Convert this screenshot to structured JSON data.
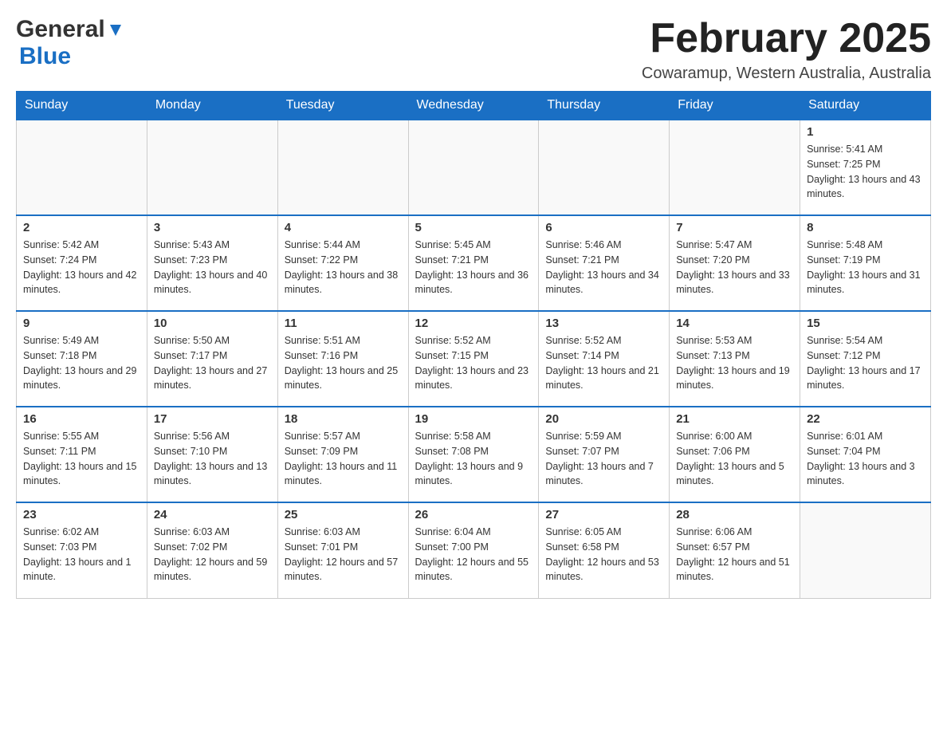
{
  "header": {
    "logo_general": "General",
    "logo_blue": "Blue",
    "month_title": "February 2025",
    "location": "Cowaramup, Western Australia, Australia"
  },
  "weekdays": [
    "Sunday",
    "Monday",
    "Tuesday",
    "Wednesday",
    "Thursday",
    "Friday",
    "Saturday"
  ],
  "weeks": [
    [
      {
        "day": "",
        "info": ""
      },
      {
        "day": "",
        "info": ""
      },
      {
        "day": "",
        "info": ""
      },
      {
        "day": "",
        "info": ""
      },
      {
        "day": "",
        "info": ""
      },
      {
        "day": "",
        "info": ""
      },
      {
        "day": "1",
        "info": "Sunrise: 5:41 AM\nSunset: 7:25 PM\nDaylight: 13 hours and 43 minutes."
      }
    ],
    [
      {
        "day": "2",
        "info": "Sunrise: 5:42 AM\nSunset: 7:24 PM\nDaylight: 13 hours and 42 minutes."
      },
      {
        "day": "3",
        "info": "Sunrise: 5:43 AM\nSunset: 7:23 PM\nDaylight: 13 hours and 40 minutes."
      },
      {
        "day": "4",
        "info": "Sunrise: 5:44 AM\nSunset: 7:22 PM\nDaylight: 13 hours and 38 minutes."
      },
      {
        "day": "5",
        "info": "Sunrise: 5:45 AM\nSunset: 7:21 PM\nDaylight: 13 hours and 36 minutes."
      },
      {
        "day": "6",
        "info": "Sunrise: 5:46 AM\nSunset: 7:21 PM\nDaylight: 13 hours and 34 minutes."
      },
      {
        "day": "7",
        "info": "Sunrise: 5:47 AM\nSunset: 7:20 PM\nDaylight: 13 hours and 33 minutes."
      },
      {
        "day": "8",
        "info": "Sunrise: 5:48 AM\nSunset: 7:19 PM\nDaylight: 13 hours and 31 minutes."
      }
    ],
    [
      {
        "day": "9",
        "info": "Sunrise: 5:49 AM\nSunset: 7:18 PM\nDaylight: 13 hours and 29 minutes."
      },
      {
        "day": "10",
        "info": "Sunrise: 5:50 AM\nSunset: 7:17 PM\nDaylight: 13 hours and 27 minutes."
      },
      {
        "day": "11",
        "info": "Sunrise: 5:51 AM\nSunset: 7:16 PM\nDaylight: 13 hours and 25 minutes."
      },
      {
        "day": "12",
        "info": "Sunrise: 5:52 AM\nSunset: 7:15 PM\nDaylight: 13 hours and 23 minutes."
      },
      {
        "day": "13",
        "info": "Sunrise: 5:52 AM\nSunset: 7:14 PM\nDaylight: 13 hours and 21 minutes."
      },
      {
        "day": "14",
        "info": "Sunrise: 5:53 AM\nSunset: 7:13 PM\nDaylight: 13 hours and 19 minutes."
      },
      {
        "day": "15",
        "info": "Sunrise: 5:54 AM\nSunset: 7:12 PM\nDaylight: 13 hours and 17 minutes."
      }
    ],
    [
      {
        "day": "16",
        "info": "Sunrise: 5:55 AM\nSunset: 7:11 PM\nDaylight: 13 hours and 15 minutes."
      },
      {
        "day": "17",
        "info": "Sunrise: 5:56 AM\nSunset: 7:10 PM\nDaylight: 13 hours and 13 minutes."
      },
      {
        "day": "18",
        "info": "Sunrise: 5:57 AM\nSunset: 7:09 PM\nDaylight: 13 hours and 11 minutes."
      },
      {
        "day": "19",
        "info": "Sunrise: 5:58 AM\nSunset: 7:08 PM\nDaylight: 13 hours and 9 minutes."
      },
      {
        "day": "20",
        "info": "Sunrise: 5:59 AM\nSunset: 7:07 PM\nDaylight: 13 hours and 7 minutes."
      },
      {
        "day": "21",
        "info": "Sunrise: 6:00 AM\nSunset: 7:06 PM\nDaylight: 13 hours and 5 minutes."
      },
      {
        "day": "22",
        "info": "Sunrise: 6:01 AM\nSunset: 7:04 PM\nDaylight: 13 hours and 3 minutes."
      }
    ],
    [
      {
        "day": "23",
        "info": "Sunrise: 6:02 AM\nSunset: 7:03 PM\nDaylight: 13 hours and 1 minute."
      },
      {
        "day": "24",
        "info": "Sunrise: 6:03 AM\nSunset: 7:02 PM\nDaylight: 12 hours and 59 minutes."
      },
      {
        "day": "25",
        "info": "Sunrise: 6:03 AM\nSunset: 7:01 PM\nDaylight: 12 hours and 57 minutes."
      },
      {
        "day": "26",
        "info": "Sunrise: 6:04 AM\nSunset: 7:00 PM\nDaylight: 12 hours and 55 minutes."
      },
      {
        "day": "27",
        "info": "Sunrise: 6:05 AM\nSunset: 6:58 PM\nDaylight: 12 hours and 53 minutes."
      },
      {
        "day": "28",
        "info": "Sunrise: 6:06 AM\nSunset: 6:57 PM\nDaylight: 12 hours and 51 minutes."
      },
      {
        "day": "",
        "info": ""
      }
    ]
  ]
}
